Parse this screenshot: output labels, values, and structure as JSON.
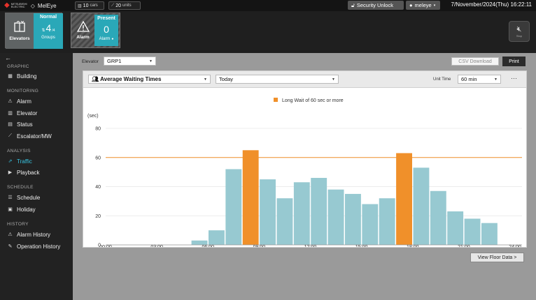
{
  "topbar": {
    "brand_small": "MITSUBISHI ELECTRIC",
    "brand": "MelEye",
    "chip1_value": "10",
    "chip1_unit": "cars",
    "chip2_value": "20",
    "chip2_unit": "units",
    "security_label": "Security Unlock",
    "user_label": "meleye",
    "datetime": "7/November/2024(Thu) 16:22:11"
  },
  "tiles": {
    "elevators_label": "Elevators",
    "normal_label": "Normal",
    "normal_count": "4",
    "normal_total": "/4",
    "groups_label": "Groups",
    "alarm_label": "Alarm",
    "present_label": "Present",
    "present_count": "0",
    "alarm_sub": "Alarm"
  },
  "sound_button_label": "Stop",
  "sidebar": {
    "sections": [
      {
        "label": "GRAPHIC",
        "items": [
          {
            "label": "Building",
            "icon": "building-icon"
          }
        ]
      },
      {
        "label": "MONITORING",
        "items": [
          {
            "label": "Alarm",
            "icon": "alarm-icon"
          },
          {
            "label": "Elevator",
            "icon": "elevator-icon"
          },
          {
            "label": "Status",
            "icon": "status-icon"
          },
          {
            "label": "Escalator/MW",
            "icon": "escalator-icon"
          }
        ]
      },
      {
        "label": "ANALYSIS",
        "items": [
          {
            "label": "Traffic",
            "icon": "traffic-icon",
            "active": true
          },
          {
            "label": "Playback",
            "icon": "playback-icon"
          }
        ]
      },
      {
        "label": "SCHEDULE",
        "items": [
          {
            "label": "Schedule",
            "icon": "schedule-icon"
          },
          {
            "label": "Holiday",
            "icon": "holiday-icon"
          }
        ]
      },
      {
        "label": "HISTORY",
        "items": [
          {
            "label": "Alarm History",
            "icon": "alarm-history-icon"
          },
          {
            "label": "Operation History",
            "icon": "operation-history-icon"
          }
        ]
      }
    ]
  },
  "main": {
    "elevator_label": "Elevator",
    "elevator_value": "GRP1",
    "csv_label": "CSV Download",
    "print_label": "Print",
    "metric_value": "Average Waiting Times",
    "period_value": "Today",
    "unit_time_label": "Unit Time",
    "unit_time_value": "60 min",
    "more_label": "···",
    "floor_button_label": "View Floor Data >"
  },
  "colors": {
    "normal_bar": "#97c9d1",
    "long_wait_bar": "#f0902a",
    "threshold_line": "#f0902a",
    "accent": "#37c3e0"
  },
  "chart_data": {
    "type": "bar",
    "ylabel": "(sec)",
    "ylim": [
      0,
      80
    ],
    "yticks": [
      "0",
      "20",
      "40",
      "60",
      "80"
    ],
    "xlim": [
      0,
      24
    ],
    "xticks": [
      "00:00",
      "03:00",
      "06:00",
      "09:00",
      "12:00",
      "15:00",
      "18:00",
      "21:00",
      "24:00"
    ],
    "threshold": 60,
    "legend": "Long Wait of 60 sec or more",
    "legend_position": "top-center",
    "grid": "horizontal",
    "bars": [
      {
        "hour": 5,
        "value": 3,
        "long": false
      },
      {
        "hour": 6,
        "value": 10,
        "long": false
      },
      {
        "hour": 7,
        "value": 52,
        "long": false
      },
      {
        "hour": 8,
        "value": 65,
        "long": true
      },
      {
        "hour": 9,
        "value": 45,
        "long": false
      },
      {
        "hour": 10,
        "value": 32,
        "long": false
      },
      {
        "hour": 11,
        "value": 43,
        "long": false
      },
      {
        "hour": 12,
        "value": 46,
        "long": false
      },
      {
        "hour": 13,
        "value": 38,
        "long": false
      },
      {
        "hour": 14,
        "value": 35,
        "long": false
      },
      {
        "hour": 15,
        "value": 28,
        "long": false
      },
      {
        "hour": 16,
        "value": 32,
        "long": false
      },
      {
        "hour": 17,
        "value": 63,
        "long": true
      },
      {
        "hour": 18,
        "value": 53,
        "long": false
      },
      {
        "hour": 19,
        "value": 37,
        "long": false
      },
      {
        "hour": 20,
        "value": 23,
        "long": false
      },
      {
        "hour": 21,
        "value": 18,
        "long": false
      },
      {
        "hour": 22,
        "value": 15,
        "long": false
      }
    ]
  }
}
